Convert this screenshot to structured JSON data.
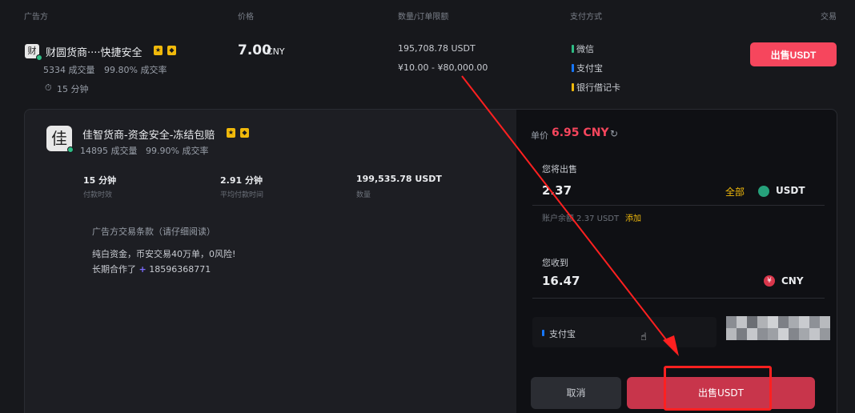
{
  "header": {
    "advertiser": "广告方",
    "price": "价格",
    "amount_limit": "数量/订单限额",
    "payment": "支付方式",
    "trade": "交易"
  },
  "ad1": {
    "avatar_char": "财",
    "name": "财圆货商····快捷安全",
    "orders": "5334 成交量",
    "rate": "99.80% 成交率",
    "time": "15 分钟",
    "price": "7.00",
    "currency": "CNY",
    "available": "195,708.78 USDT",
    "limit": "¥10.00 - ¥80,000.00",
    "payments": [
      "微信",
      "支付宝",
      "银行借记卡"
    ],
    "payment_colors": [
      "#2ebd85",
      "#1677ff",
      "#f0b90b"
    ],
    "sell_label": "出售USDT"
  },
  "ad2": {
    "avatar_char": "佳",
    "name": "佳智货商-资金安全-冻结包赔",
    "orders": "14895 成交量",
    "rate": "99.90% 成交率",
    "stats": [
      {
        "value": "15 分钟",
        "label": "付款时效"
      },
      {
        "value": "2.91 分钟",
        "label": "平均付款时间"
      },
      {
        "value": "199,535.78 USDT",
        "label": "数量"
      }
    ],
    "terms_title": "广告方交易条款（请仔细阅读）",
    "terms_line1": "纯白资金，币安交易40万单，0风险!",
    "terms_line2_prefix": "长期合作了",
    "terms_line2_number": "18596368771"
  },
  "order": {
    "unit_price_label": "单价",
    "unit_price": "6.95 CNY",
    "sell_label": "您将出售",
    "sell_value": "2.37",
    "all_label": "全部",
    "sell_coin": "USDT",
    "balance_prefix": "账户余额 2.37 USDT",
    "add_label": "添加",
    "receive_label": "您收到",
    "receive_value": "16.47",
    "receive_coin": "CNY",
    "method": "支付宝",
    "cancel_label": "取消",
    "confirm_label": "出售USDT"
  },
  "colors": {
    "accent_red": "#f6465d",
    "gold": "#f0b90b",
    "tether": "#26a17b"
  }
}
